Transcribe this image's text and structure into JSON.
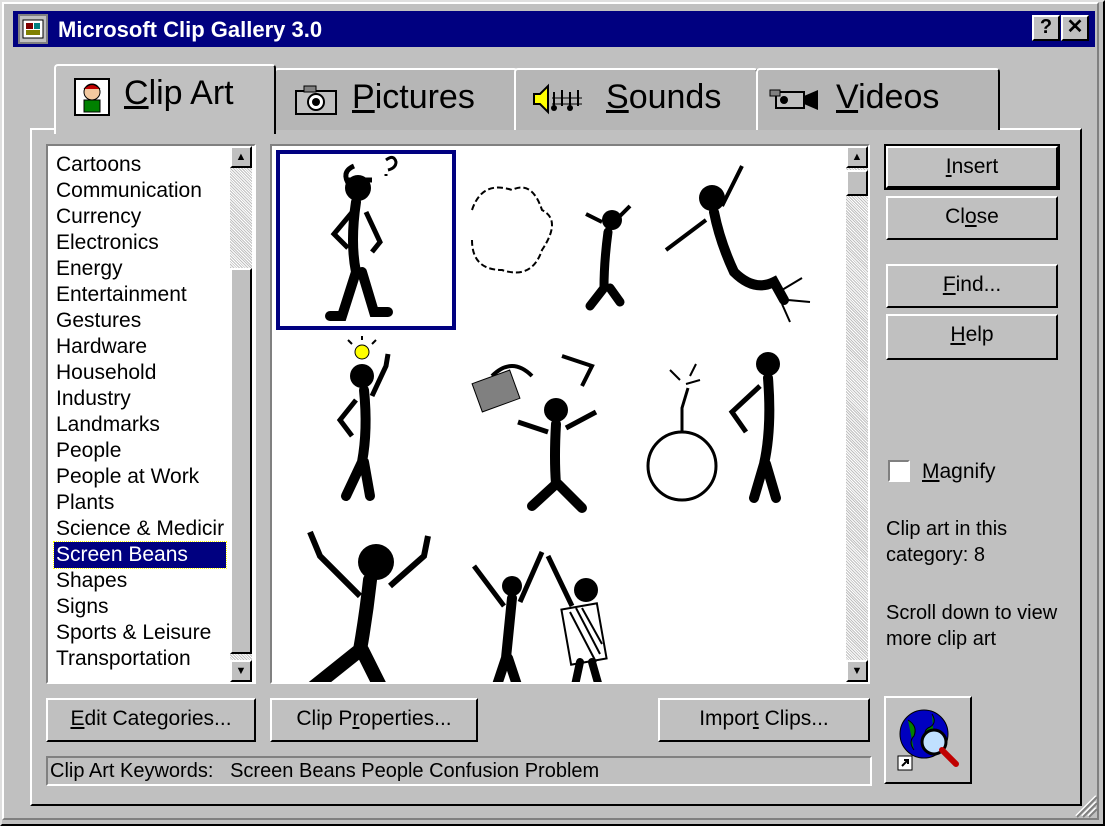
{
  "window": {
    "title": "Microsoft Clip Gallery 3.0",
    "help_btn": "?",
    "close_btn": "✕"
  },
  "tabs": [
    {
      "accel": "C",
      "rest": "lip Art"
    },
    {
      "accel": "P",
      "rest": "ictures"
    },
    {
      "accel": "S",
      "rest": "ounds"
    },
    {
      "accel": "V",
      "rest": "ideos"
    }
  ],
  "categories": {
    "items": [
      "Cartoons",
      "Communication",
      "Currency",
      "Electronics",
      "Energy",
      "Entertainment",
      "Gestures",
      "Hardware",
      "Household",
      "Industry",
      "Landmarks",
      "People",
      "People at Work",
      "Plants",
      "Science & Medicir",
      "Screen Beans",
      "Shapes",
      "Signs",
      "Sports & Leisure",
      "Transportation"
    ],
    "selected": "Screen Beans"
  },
  "buttons": {
    "insert": "Insert",
    "close": "Close",
    "find": "Find...",
    "help": "Help",
    "edit_categories": "Edit Categories...",
    "clip_properties": "Clip Properties...",
    "import_clips": "Import Clips..."
  },
  "magnify": {
    "label": "Magnify",
    "checked": false
  },
  "info": {
    "count_text": "Clip art in this category: 8",
    "scroll_hint": "Scroll down to view more clip art"
  },
  "keywords": {
    "label": "Clip Art Keywords:",
    "value": "Screen Beans People Confusion Problem"
  }
}
